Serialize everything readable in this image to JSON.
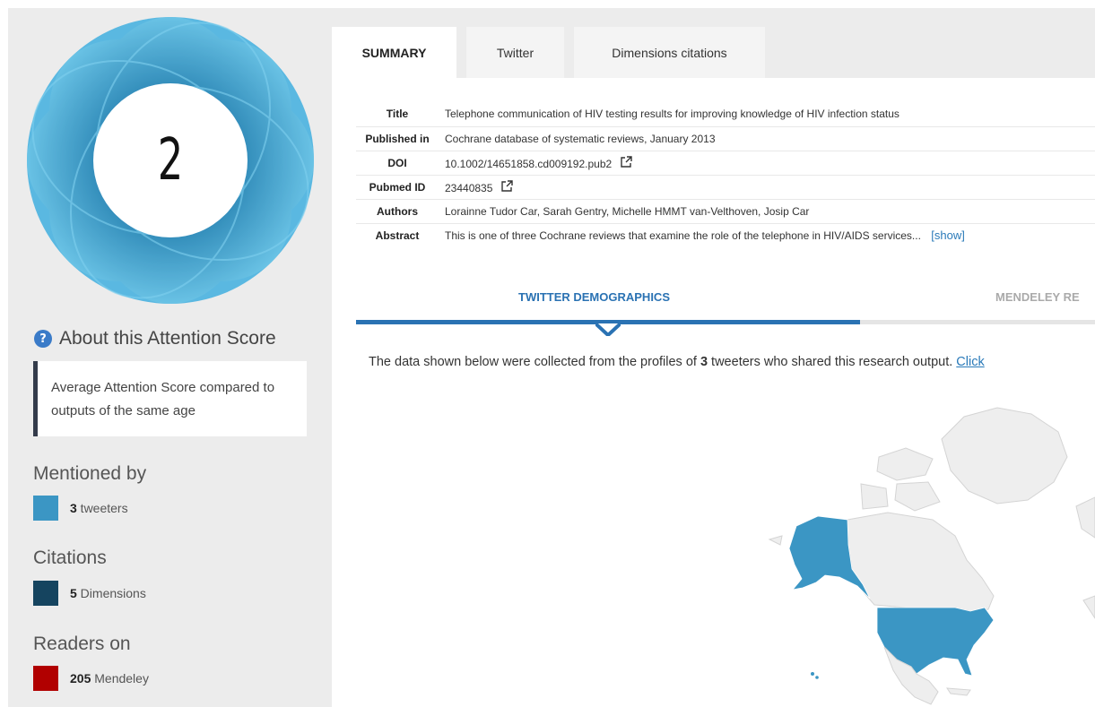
{
  "score": "2",
  "about": {
    "label": "About this Attention Score"
  },
  "score_box": {
    "text": "Average Attention Score compared to outputs of the same age"
  },
  "mentioned": {
    "title": "Mentioned by",
    "count": "3",
    "label": " tweeters",
    "color": "#3b96c4"
  },
  "citations": {
    "title": "Citations",
    "count": "5",
    "label": " Dimensions",
    "color": "#15445f"
  },
  "readers": {
    "title": "Readers on",
    "count": "205",
    "label": " Mendeley",
    "color": "#b10000"
  },
  "tabs": [
    {
      "label": "SUMMARY",
      "active": true
    },
    {
      "label": "Twitter",
      "active": false
    },
    {
      "label": "Dimensions citations",
      "active": false
    }
  ],
  "summary": {
    "rows": [
      {
        "label": "Title",
        "value": "Telephone communication of HIV testing results for improving knowledge of HIV infection status"
      },
      {
        "label": "Published in",
        "value": "Cochrane database of systematic reviews, January 2013"
      },
      {
        "label": "DOI",
        "value": "10.1002/14651858.cd009192.pub2"
      },
      {
        "label": "Pubmed ID",
        "value": "23440835"
      },
      {
        "label": "Authors",
        "value": "Lorainne Tudor Car, Sarah Gentry, Michelle HMMT van-Velthoven, Josip Car"
      },
      {
        "label": "Abstract",
        "value": "This is one of three Cochrane reviews that examine the role of the telephone in HIV/AIDS services..."
      }
    ],
    "show_link": "[show]"
  },
  "demographics": {
    "tab_twitter": "TWITTER DEMOGRAPHICS",
    "tab_mendeley": "MENDELEY RE",
    "desc_prefix": "The data shown below were collected from the profiles of ",
    "desc_count": "3",
    "desc_suffix": " tweeters who shared this research output. ",
    "desc_link": "Click"
  }
}
